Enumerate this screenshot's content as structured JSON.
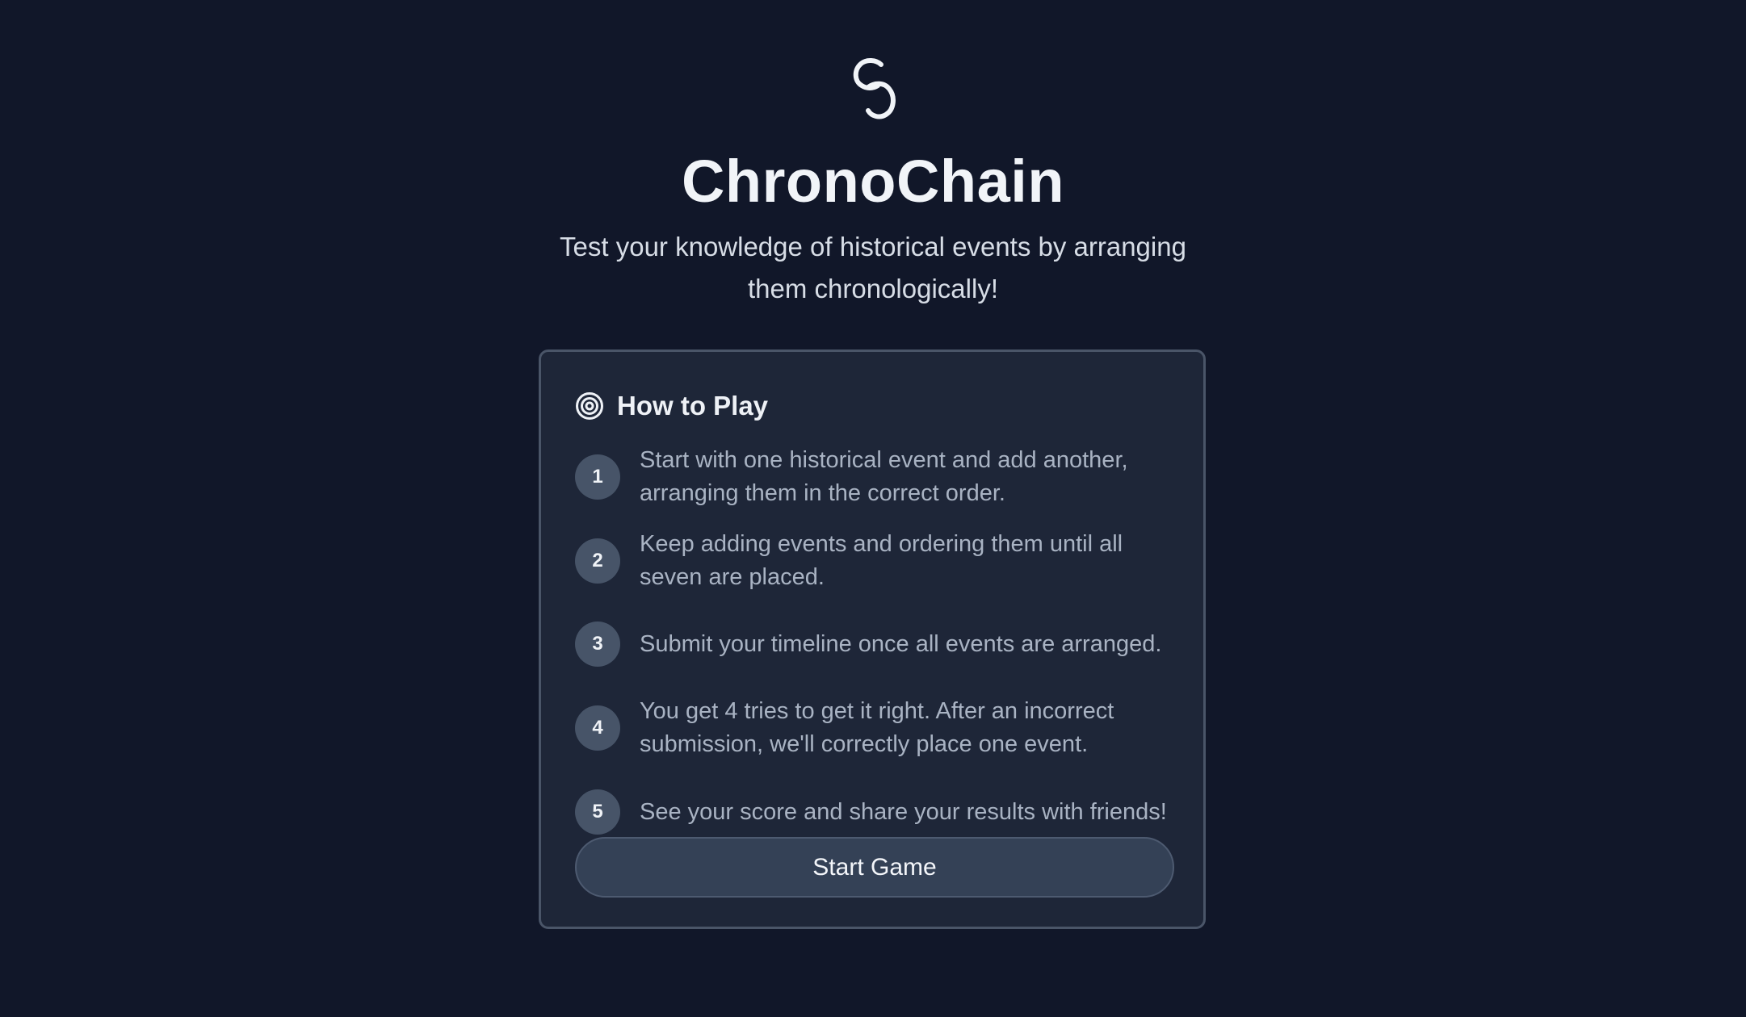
{
  "app": {
    "logo_icon": "chain-link-icon",
    "title": "ChronoChain",
    "subtitle": "Test your knowledge of historical events by arranging them chronologically!"
  },
  "how_to_play": {
    "icon": "target-icon",
    "heading": "How to Play",
    "steps": [
      {
        "number": "1",
        "text": "Start with one historical event and add another, arranging them in the correct order."
      },
      {
        "number": "2",
        "text": "Keep adding events and ordering them until all seven are placed."
      },
      {
        "number": "3",
        "text": "Submit your timeline once all events are arranged."
      },
      {
        "number": "4",
        "text": "You get 4 tries to get it right. After an incorrect submission, we'll correctly place one event."
      },
      {
        "number": "5",
        "text": "See your score and share your results with friends!"
      }
    ],
    "start_button_label": "Start Game"
  },
  "colors": {
    "background": "#111729",
    "card": "#1e2638",
    "card_border": "#4a5568",
    "step_badge": "#475468",
    "button": "#344156"
  }
}
